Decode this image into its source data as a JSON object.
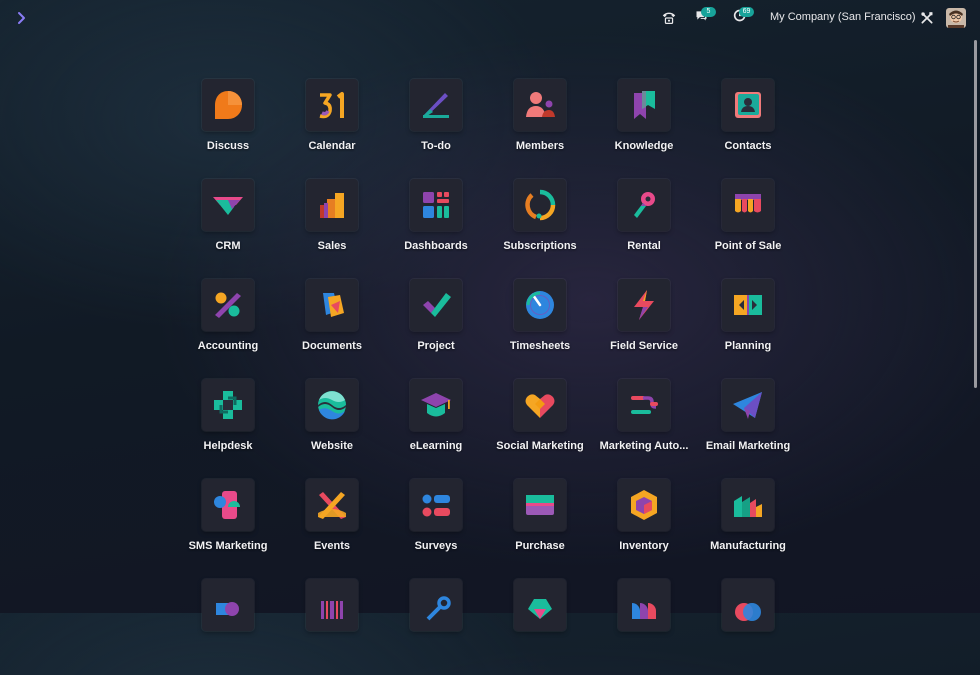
{
  "topbar": {
    "menu_toggle_icon": "chevron-right-icon",
    "phone_icon": "phone-icon",
    "messages": {
      "icon": "chat-icon",
      "count": "5"
    },
    "activities": {
      "icon": "clock-icon",
      "count": "69"
    },
    "company": "My Company (San Francisco)",
    "debug_icon": "tools-icon",
    "avatar_icon": "user-avatar-icon"
  },
  "apps": [
    {
      "label": "Discuss",
      "icon": "discuss-icon"
    },
    {
      "label": "Calendar",
      "icon": "calendar-icon"
    },
    {
      "label": "To-do",
      "icon": "todo-icon"
    },
    {
      "label": "Members",
      "icon": "members-icon"
    },
    {
      "label": "Knowledge",
      "icon": "knowledge-icon"
    },
    {
      "label": "Contacts",
      "icon": "contacts-icon"
    },
    {
      "label": "CRM",
      "icon": "crm-icon"
    },
    {
      "label": "Sales",
      "icon": "sales-icon"
    },
    {
      "label": "Dashboards",
      "icon": "dashboards-icon"
    },
    {
      "label": "Subscriptions",
      "icon": "subscriptions-icon"
    },
    {
      "label": "Rental",
      "icon": "rental-icon"
    },
    {
      "label": "Point of Sale",
      "icon": "point-of-sale-icon"
    },
    {
      "label": "Accounting",
      "icon": "accounting-icon"
    },
    {
      "label": "Documents",
      "icon": "documents-icon"
    },
    {
      "label": "Project",
      "icon": "project-icon"
    },
    {
      "label": "Timesheets",
      "icon": "timesheets-icon"
    },
    {
      "label": "Field Service",
      "icon": "field-service-icon"
    },
    {
      "label": "Planning",
      "icon": "planning-icon"
    },
    {
      "label": "Helpdesk",
      "icon": "helpdesk-icon"
    },
    {
      "label": "Website",
      "icon": "website-icon"
    },
    {
      "label": "eLearning",
      "icon": "elearning-icon"
    },
    {
      "label": "Social Marketing",
      "icon": "social-marketing-icon"
    },
    {
      "label": "Marketing Auto...",
      "icon": "marketing-automation-icon"
    },
    {
      "label": "Email Marketing",
      "icon": "email-marketing-icon"
    },
    {
      "label": "SMS Marketing",
      "icon": "sms-marketing-icon"
    },
    {
      "label": "Events",
      "icon": "events-icon"
    },
    {
      "label": "Surveys",
      "icon": "surveys-icon"
    },
    {
      "label": "Purchase",
      "icon": "purchase-icon"
    },
    {
      "label": "Inventory",
      "icon": "inventory-icon"
    },
    {
      "label": "Manufacturing",
      "icon": "manufacturing-icon"
    },
    {
      "label": "",
      "icon": "partial-app-icon-1"
    },
    {
      "label": "",
      "icon": "barcode-icon"
    },
    {
      "label": "",
      "icon": "partial-app-icon-3"
    },
    {
      "label": "",
      "icon": "partial-app-icon-4"
    },
    {
      "label": "",
      "icon": "partial-app-icon-5"
    },
    {
      "label": "",
      "icon": "partial-app-icon-6"
    }
  ],
  "colors": {
    "accent": "#18a39a",
    "chevron": "#7b6cf0",
    "tile_bg": "#232530"
  }
}
